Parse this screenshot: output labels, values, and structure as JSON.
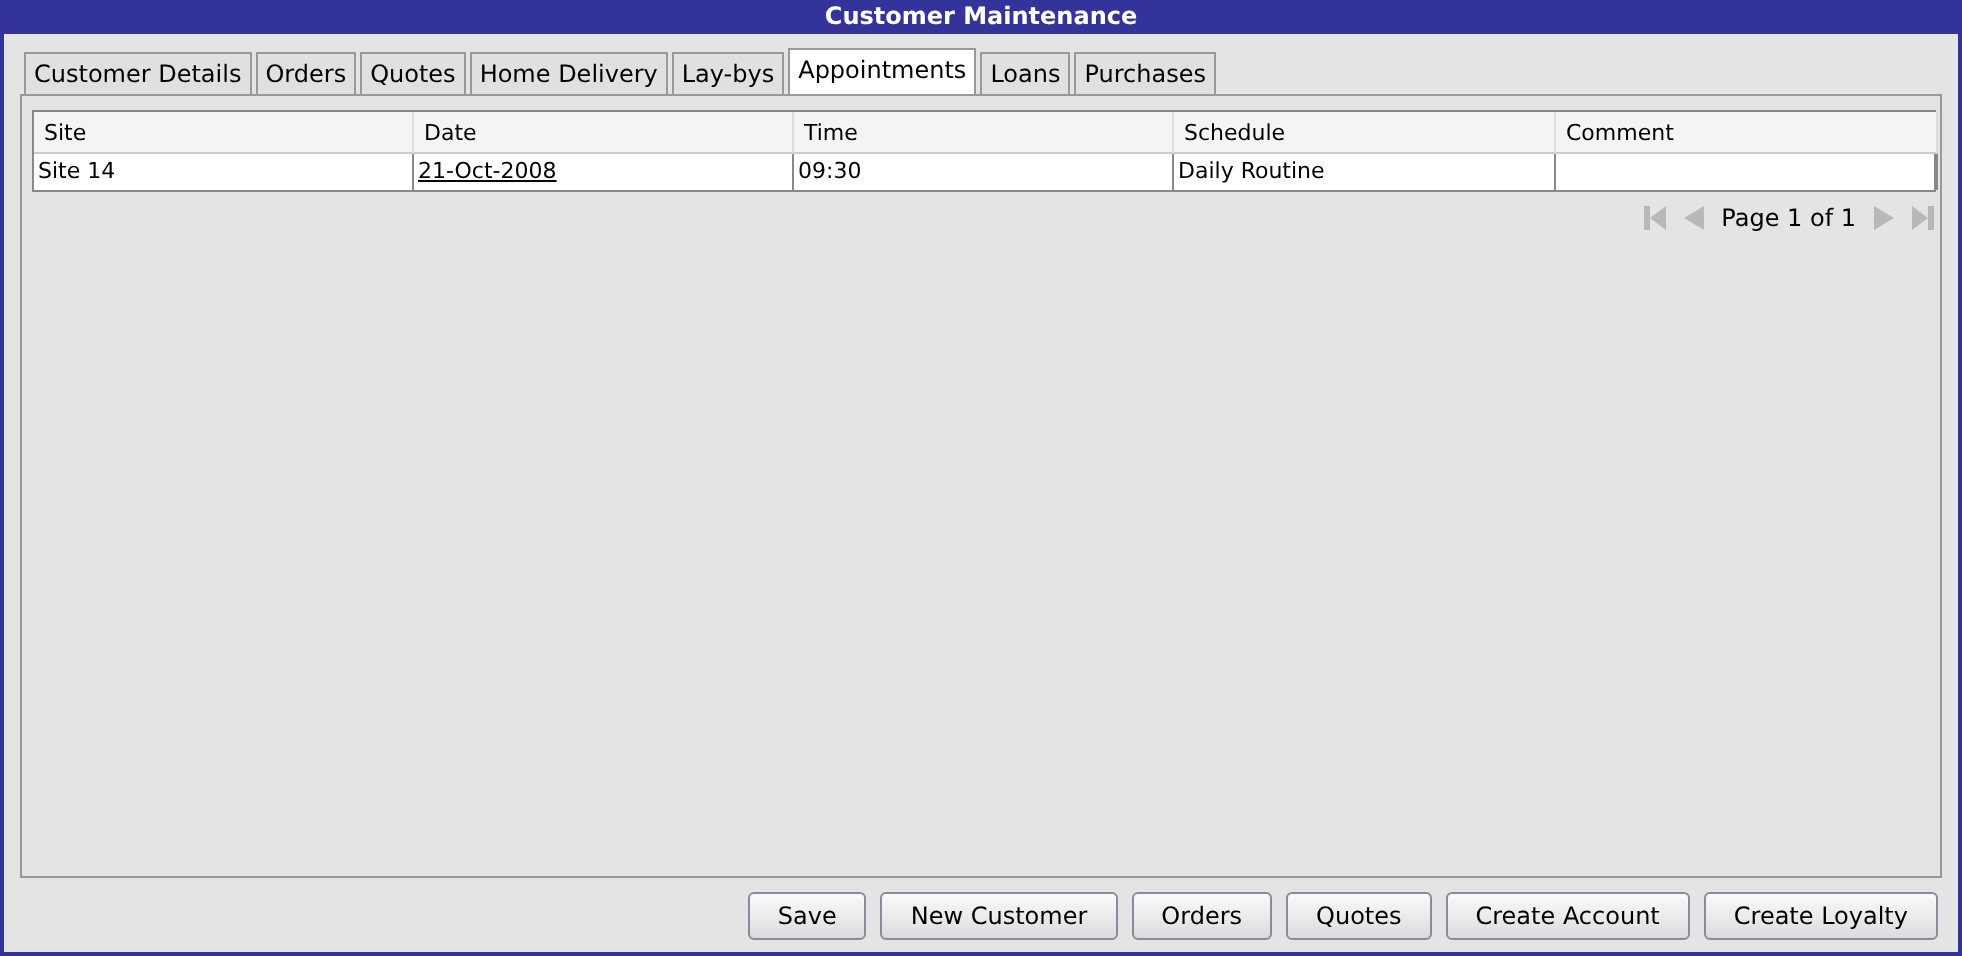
{
  "window": {
    "title": "Customer Maintenance"
  },
  "tabs": [
    {
      "label": "Customer Details",
      "selected": false
    },
    {
      "label": "Orders",
      "selected": false
    },
    {
      "label": "Quotes",
      "selected": false
    },
    {
      "label": "Home Delivery",
      "selected": false
    },
    {
      "label": "Lay-bys",
      "selected": false
    },
    {
      "label": "Appointments",
      "selected": true
    },
    {
      "label": "Loans",
      "selected": false
    },
    {
      "label": "Purchases",
      "selected": false
    }
  ],
  "table": {
    "columns": [
      "Site",
      "Date",
      "Time",
      "Schedule",
      "Comment"
    ],
    "rows": [
      {
        "cells": [
          {
            "text": "Site 14",
            "kind": "text"
          },
          {
            "text": "21-Oct-2008",
            "kind": "link"
          },
          {
            "text": "09:30",
            "kind": "text"
          },
          {
            "text": "Daily Routine",
            "kind": "text"
          },
          {
            "text": "",
            "kind": "text"
          }
        ]
      }
    ]
  },
  "pager": {
    "label": "Page 1 of 1",
    "first_disabled": true,
    "prev_disabled": true,
    "next_disabled": true,
    "last_disabled": true
  },
  "buttons": [
    "Save",
    "New Customer",
    "Orders",
    "Quotes",
    "Create Account",
    "Create Loyalty"
  ]
}
